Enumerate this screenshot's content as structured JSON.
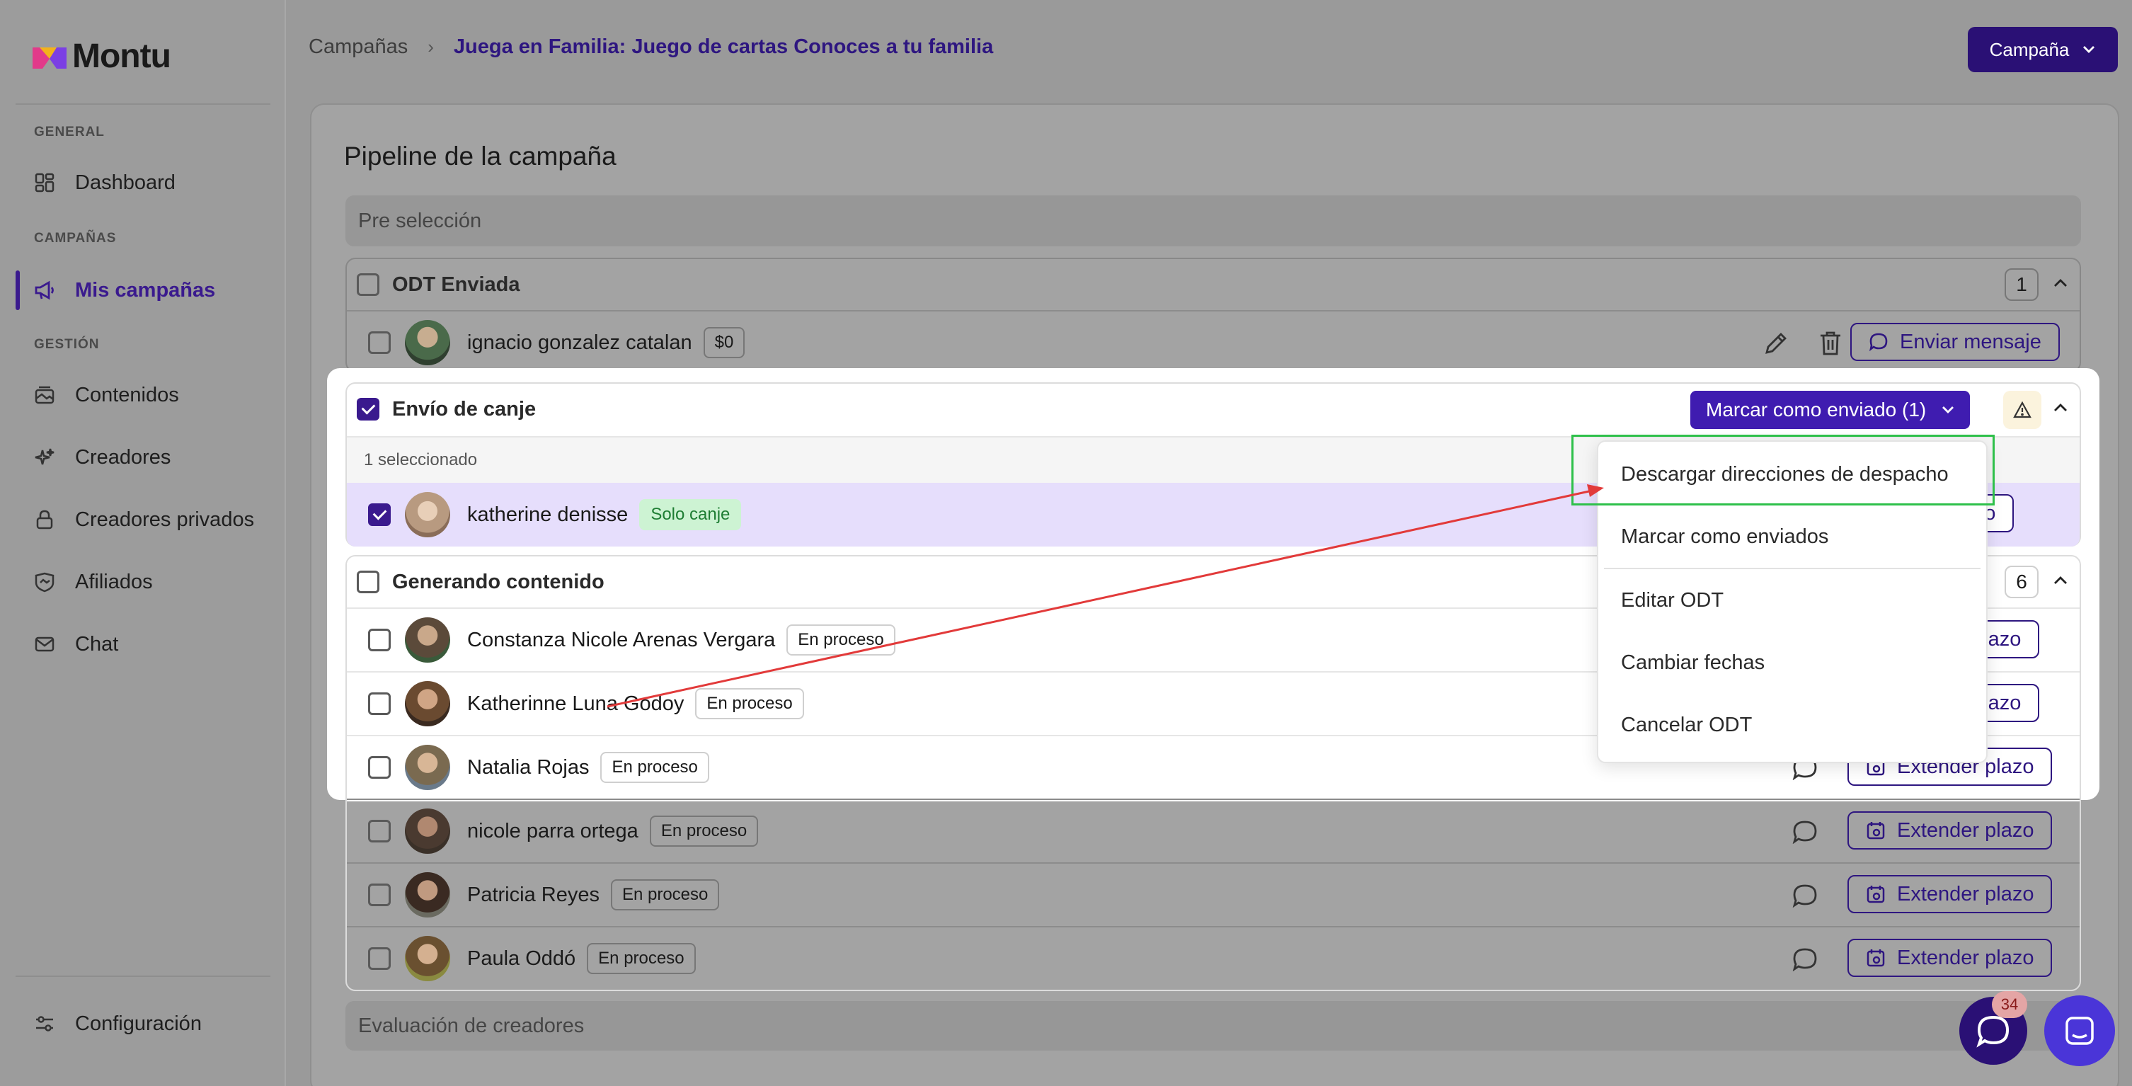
{
  "brand": {
    "name": "Montu",
    "accent": "#3a1a8e"
  },
  "sidebar": {
    "sections": [
      {
        "label": "GENERAL"
      },
      {
        "label": "CAMPAÑAS"
      },
      {
        "label": "GESTIÓN"
      }
    ],
    "items": [
      {
        "label": "Dashboard",
        "icon": "dashboard-icon"
      },
      {
        "label": "Mis campañas",
        "icon": "megaphone-icon",
        "active": true
      },
      {
        "label": "Contenidos",
        "icon": "content-icon"
      },
      {
        "label": "Creadores",
        "icon": "sparkle-icon"
      },
      {
        "label": "Creadores privados",
        "icon": "lock-icon"
      },
      {
        "label": "Afiliados",
        "icon": "handshake-icon"
      },
      {
        "label": "Chat",
        "icon": "mail-icon"
      }
    ],
    "footer_item": {
      "label": "Configuración",
      "icon": "sliders-icon"
    }
  },
  "breadcrumb": {
    "root": "Campañas",
    "current": "Juega en Familia: Juego de cartas Conoces a tu familia"
  },
  "campaign_button": {
    "label": "Campaña"
  },
  "main": {
    "title": "Pipeline de la campaña",
    "stages": {
      "pre": "Pre selección",
      "eval": "Evaluación de creadores"
    },
    "odt_group": {
      "title": "ODT Enviada",
      "count": "1",
      "row": {
        "name": "ignacio gonzalez catalan",
        "tag": "$0",
        "action": "Enviar mensaje"
      }
    },
    "envio_group": {
      "title": "Envío de canje",
      "action_button": "Marcar como enviado (1)",
      "selected_text": "1 seleccionado",
      "row": {
        "name": "katherine denisse",
        "tag": "Solo canje",
        "action_partial": "viado"
      }
    },
    "gen_group": {
      "title": "Generando contenido",
      "count": "6",
      "rows": [
        {
          "name": "Constanza Nicole Arenas Vergara",
          "tag": "En proceso",
          "action": "plazo"
        },
        {
          "name": "Katherinne Luna Godoy",
          "tag": "En proceso",
          "action": "plazo"
        },
        {
          "name": "Natalia Rojas",
          "tag": "En proceso",
          "action": "Extender plazo"
        },
        {
          "name": "nicole parra ortega",
          "tag": "En proceso",
          "action": "Extender plazo"
        },
        {
          "name": "Patricia Reyes",
          "tag": "En proceso",
          "action": "Extender plazo"
        },
        {
          "name": "Paula Oddó",
          "tag": "En proceso",
          "action": "Extender plazo"
        }
      ]
    }
  },
  "dropdown": {
    "items": [
      "Descargar direcciones de despacho",
      "Marcar como enviados",
      "Editar ODT",
      "Cambiar fechas",
      "Cancelar ODT"
    ]
  },
  "chat_badge": "34"
}
